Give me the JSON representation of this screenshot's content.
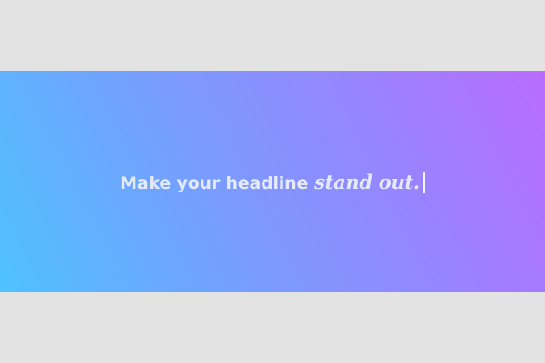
{
  "hero": {
    "headline_prefix": "Make your headline",
    "headline_accent": "stand out."
  },
  "colors": {
    "page_background": "#e3e3e3",
    "gradient_start": "#4fc2ff",
    "gradient_end": "#b96cff",
    "headline_text": "#e4eaf8"
  }
}
